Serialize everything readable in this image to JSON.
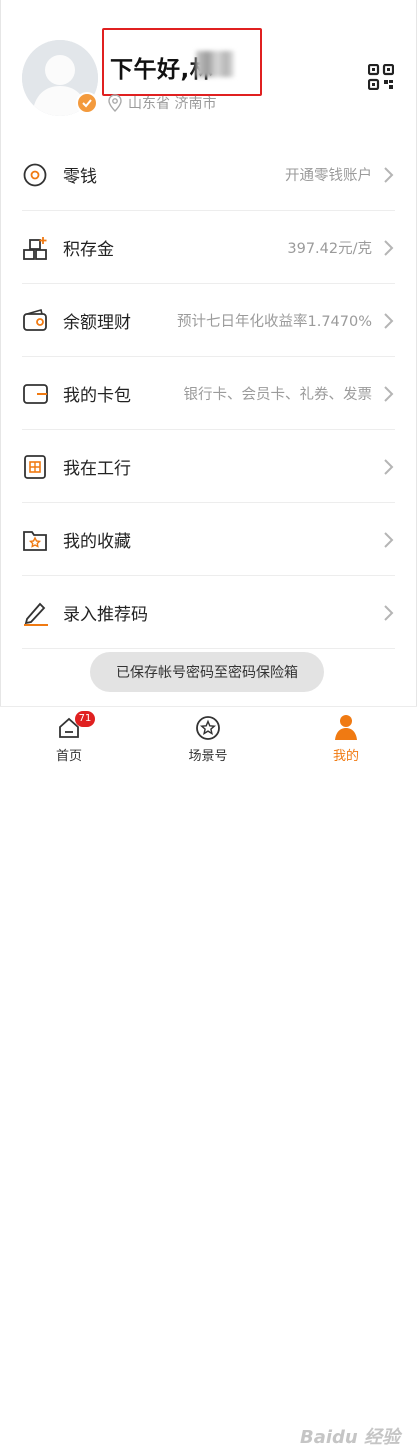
{
  "header": {
    "greeting": "下午好,林",
    "location": "山东省 济南市"
  },
  "menu": [
    {
      "icon": "coin-icon",
      "label": "零钱",
      "value": "开通零钱账户"
    },
    {
      "icon": "gold-bars-icon",
      "label": "积存金",
      "value": "397.42元/克"
    },
    {
      "icon": "wallet-icon",
      "label": "余额理财",
      "value": "预计七日年化收益率1.7470%"
    },
    {
      "icon": "card-case-icon",
      "label": "我的卡包",
      "value": "银行卡、会员卡、礼券、发票"
    },
    {
      "icon": "id-card-icon",
      "label": "我在工行",
      "value": ""
    },
    {
      "icon": "star-folder-icon",
      "label": "我的收藏",
      "value": ""
    },
    {
      "icon": "pen-icon",
      "label": "录入推荐码",
      "value": ""
    }
  ],
  "toast": "已保存帐号密码至密码保险箱",
  "tabbar": {
    "home": {
      "label": "首页",
      "badge": "71"
    },
    "scene": {
      "label": "场景号"
    },
    "me": {
      "label": "我的"
    }
  },
  "watermark": "Baidu 经验",
  "colors": {
    "accent": "#f07a12",
    "highlight": "#e02020",
    "text": "#222222",
    "muted": "#9b9b9b"
  }
}
